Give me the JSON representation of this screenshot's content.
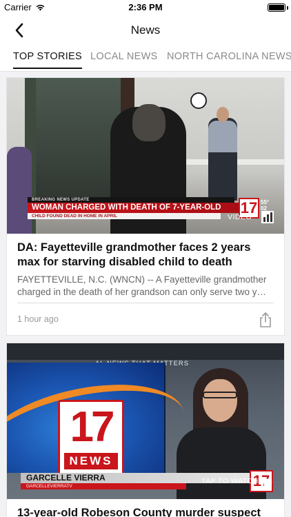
{
  "status_bar": {
    "carrier": "Carrier",
    "time": "2:36 PM",
    "battery_level": 1.0
  },
  "nav": {
    "title": "News",
    "back_icon": "chevron-left-icon"
  },
  "tabs": [
    {
      "label": "TOP STORIES",
      "active": true
    },
    {
      "label": "LOCAL NEWS",
      "active": false
    },
    {
      "label": "NORTH CAROLINA NEWS",
      "active": false
    }
  ],
  "stories": [
    {
      "headline": "DA: Fayetteville grandmother faces 2 years max for starving disabled child to death",
      "summary": "FAYETTEVILLE, N.C. (WNCN) -- A Fayetteville grandmother charged in the death of her grandson can only serve two y…",
      "timestamp": "1 hour ago",
      "media_label": "VIDEO",
      "image": {
        "breaking": "BREAKING NEWS UPDATE",
        "chyron": "WOMAN CHARGED WITH DEATH OF 7-YEAR-OLD",
        "subline": "CHILD FOUND DEAD IN HOME IN APRIL",
        "logo": "17",
        "temp": "55°",
        "temp2": "02"
      }
    },
    {
      "headline": "13-year-old Robeson County murder suspect",
      "media_label": "TAP TO WATCH",
      "image": {
        "banner": "AL NEWS THAT MATTERS",
        "logo_number": "17",
        "logo_text": "NEWS",
        "anchor_name": "GARCELLE VIERRA",
        "anchor_handle": "GARCELLEVIERRATV",
        "corner_logo": "17"
      }
    }
  ],
  "colors": {
    "accent": "#111111",
    "tab_inactive": "#8a8a8a",
    "brand_red": "#c9151b"
  }
}
